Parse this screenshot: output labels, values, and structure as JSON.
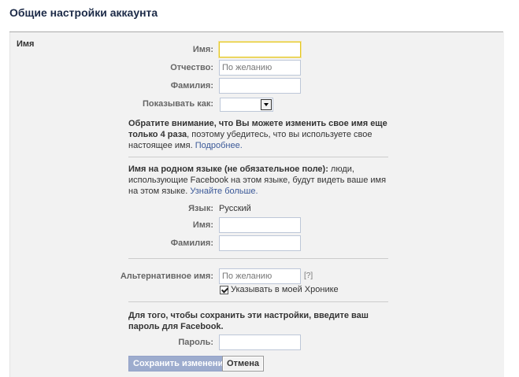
{
  "page_title": "Общие настройки аккаунта",
  "section_label": "Имя",
  "fields": {
    "first_name_label": "Имя:",
    "middle_name_label": "Отчество:",
    "middle_name_placeholder": "По желанию",
    "last_name_label": "Фамилия:",
    "display_as_label": "Показывать как:"
  },
  "notice": {
    "bold": "Обратите внимание, что Вы можете изменить свое имя еще только 4 раза",
    "rest": ", поэтому убедитесь, что вы используете свое настоящее имя.",
    "link": "Подробнее."
  },
  "native": {
    "intro_bold": "Имя на родном языке (не обязательное поле):",
    "intro_rest": " люди, использующие Facebook на этом языке, будут видеть ваше имя на этом языке.",
    "link": "Узнайте больше.",
    "language_label": "Язык:",
    "language_value": "Русский",
    "first_name_label": "Имя:",
    "last_name_label": "Фамилия:"
  },
  "alternate": {
    "label": "Альтернативное имя:",
    "placeholder": "По желанию",
    "help": "[?]",
    "checkbox_label": "Указывать в моей Хронике"
  },
  "password": {
    "prompt": "Для того, чтобы сохранить эти настройки, введите ваш пароль для Facebook.",
    "label": "Пароль:"
  },
  "buttons": {
    "save": "Сохранить изменения",
    "cancel": "Отмена"
  }
}
